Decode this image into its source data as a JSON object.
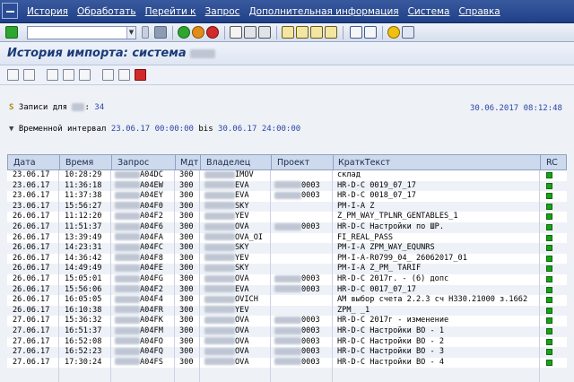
{
  "menu": [
    "История",
    "Обработать",
    "Перейти к",
    "Запрос",
    "Дополнительная информация",
    "Система",
    "Справка"
  ],
  "title": "История импорта: система",
  "info": {
    "records_label": "Записи для",
    "records_count": "34",
    "datetime": "30.06.2017 08:12:48",
    "interval_label": "Временной интервал",
    "interval_from": "23.06.17 00:00:00",
    "bis": "bis",
    "interval_to": "30.06.17 24:00:00"
  },
  "table": {
    "headers": [
      "Дата",
      "Время",
      "Запрос",
      "Мдт",
      "Владелец",
      "Проект",
      "КраткТекст",
      "RC"
    ],
    "rows": [
      {
        "date": "23.06.17",
        "time": "10:28:29",
        "req": "A04DC",
        "mdt": "300",
        "owner": "IMOV",
        "proj": "",
        "text": "склад"
      },
      {
        "date": "23.06.17",
        "time": "11:36:18",
        "req": "A04EW",
        "mdt": "300",
        "owner": "EVA",
        "proj": "0003",
        "text": "HR-D-C 0019_07_17"
      },
      {
        "date": "23.06.17",
        "time": "11:37:38",
        "req": "A04EY",
        "mdt": "300",
        "owner": "EVA",
        "proj": "0003",
        "text": "HR-D-C 0018_07_17"
      },
      {
        "date": "23.06.17",
        "time": "15:56:27",
        "req": "A04F0",
        "mdt": "300",
        "owner": "SKY",
        "proj": "",
        "text": "PM-I-A Z"
      },
      {
        "date": "26.06.17",
        "time": "11:12:20",
        "req": "A04F2",
        "mdt": "300",
        "owner": "YEV",
        "proj": "",
        "text": "Z_PM_WAY_TPLNR_GENTABLES_1"
      },
      {
        "date": "26.06.17",
        "time": "11:51:37",
        "req": "A04F6",
        "mdt": "300",
        "owner": "OVA",
        "proj": "0003",
        "text": "HR-D-C Настройки по ШР."
      },
      {
        "date": "26.06.17",
        "time": "13:39:49",
        "req": "A04FA",
        "mdt": "300",
        "owner": "OVA_OI",
        "proj": "",
        "text": "FI_REAL_PASS"
      },
      {
        "date": "26.06.17",
        "time": "14:23:31",
        "req": "A04FC",
        "mdt": "300",
        "owner": "SKY",
        "proj": "",
        "text": "PM-I-A ZPM_WAY_EQUNRS"
      },
      {
        "date": "26.06.17",
        "time": "14:36:42",
        "req": "A04F8",
        "mdt": "300",
        "owner": "YEV",
        "proj": "",
        "text": "PM-I-A-R0799_04_          26062017_01"
      },
      {
        "date": "26.06.17",
        "time": "14:49:49",
        "req": "A04FE",
        "mdt": "300",
        "owner": "SKY",
        "proj": "",
        "text": "PM-I-A Z_PM_            TARIF"
      },
      {
        "date": "26.06.17",
        "time": "15:05:01",
        "req": "A04FG",
        "mdt": "300",
        "owner": "OVA",
        "proj": "0003",
        "text": "HR-D-C                 2017г. - (6) допс"
      },
      {
        "date": "26.06.17",
        "time": "15:56:06",
        "req": "A04F2",
        "mdt": "300",
        "owner": "EVA",
        "proj": "0003",
        "text": "HR-D-C 0017_07_17"
      },
      {
        "date": "26.06.17",
        "time": "16:05:05",
        "req": "A04F4",
        "mdt": "300",
        "owner": "OVICH",
        "proj": "",
        "text": "AM выбор счета 2.2.3 сч Н330.21000 з.1662"
      },
      {
        "date": "26.06.17",
        "time": "16:10:38",
        "req": "A04FR",
        "mdt": "300",
        "owner": "YEV",
        "proj": "",
        "text": "ZPM_          _1"
      },
      {
        "date": "27.06.17",
        "time": "15:36:32",
        "req": "A04FK",
        "mdt": "300",
        "owner": "OVA",
        "proj": "0003",
        "text": "HR-D-C                 2017г - изменение"
      },
      {
        "date": "27.06.17",
        "time": "16:51:37",
        "req": "A04FM",
        "mdt": "300",
        "owner": "OVA",
        "proj": "0003",
        "text": "HR-D-C Настройки ВО - 1"
      },
      {
        "date": "27.06.17",
        "time": "16:52:08",
        "req": "A04FO",
        "mdt": "300",
        "owner": "OVA",
        "proj": "0003",
        "text": "HR-D-C Настройки ВО - 2"
      },
      {
        "date": "27.06.17",
        "time": "16:52:23",
        "req": "A04FQ",
        "mdt": "300",
        "owner": "OVA",
        "proj": "0003",
        "text": "HR-D-C Настройки ВО - 3"
      },
      {
        "date": "27.06.17",
        "time": "17:30:24",
        "req": "A04FS",
        "mdt": "300",
        "owner": "OVA",
        "proj": "0003",
        "text": "HR-D-C Настройки ВО - 4"
      }
    ]
  },
  "colors": {
    "rc_ok": "#1aa01a",
    "menubar": "#2c4d96",
    "title": "#1b3a78"
  },
  "icons": [
    "check-icon",
    "back-icon",
    "save-icon",
    "exit-icon",
    "cancel-icon",
    "print-icon",
    "find-icon",
    "find-next-icon",
    "first-page-icon",
    "prev-page-icon",
    "next-page-icon",
    "last-page-icon",
    "new-session-icon",
    "shortcut-icon",
    "help-icon",
    "layout-icon"
  ]
}
